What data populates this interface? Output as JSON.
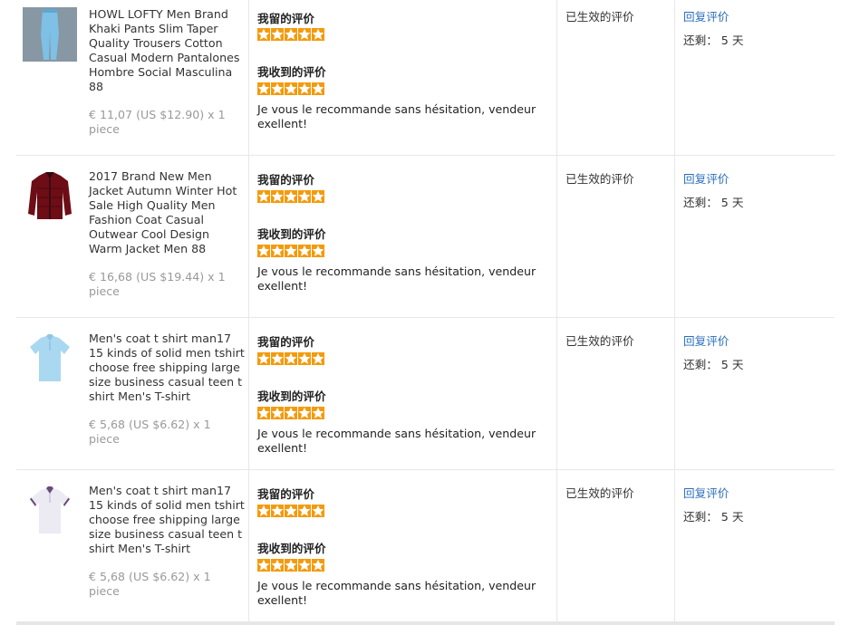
{
  "labels": {
    "my_review": "我留的评价",
    "received_review": "我收到的评价",
    "status": "已生效的评价",
    "reply": "回复评价",
    "remaining_prefix": "还剩：",
    "remaining_value": "5 天"
  },
  "colors": {
    "star": "#f59a0b",
    "link": "#2a6ebb",
    "price": "#999999"
  },
  "rows": [
    {
      "thumb_icon": "jeans-icon",
      "title": "HOWL LOFTY Men Brand Khaki Pants Slim Taper Quality Trousers Cotton Casual Modern Pantalones Hombre Social Masculina 88",
      "price": "€ 11,07 (US $12.90) x 1 piece",
      "my_rating": 5,
      "received_rating": 5,
      "comment": "Je vous le recommande sans hésitation, vendeur exellent!"
    },
    {
      "thumb_icon": "jacket-icon",
      "title": "2017 Brand New Men Jacket Autumn Winter Hot Sale High Quality Men Fashion Coat Casual Outwear Cool Design Warm Jacket Men 88",
      "price": "€ 16,68 (US $19.44) x 1 piece",
      "my_rating": 5,
      "received_rating": 5,
      "comment": "Je vous le recommande sans hésitation, vendeur exellent!"
    },
    {
      "thumb_icon": "polo-shirt-icon",
      "title": "Men's coat t shirt man17 15 kinds of solid men tshirt choose free shipping large size business casual teen t shirt Men's T-shirt",
      "price": "€ 5,68 (US $6.62) x 1 piece",
      "my_rating": 5,
      "received_rating": 5,
      "comment": "Je vous le recommande sans hésitation, vendeur exellent!"
    },
    {
      "thumb_icon": "polo-shirt-icon",
      "title": "Men's coat t shirt man17 15 kinds of solid men tshirt choose free shipping large size business casual teen t shirt Men's T-shirt",
      "price": "€ 5,68 (US $6.62) x 1 piece",
      "my_rating": 5,
      "received_rating": 5,
      "comment": "Je vous le recommande sans hésitation, vendeur exellent!"
    }
  ]
}
